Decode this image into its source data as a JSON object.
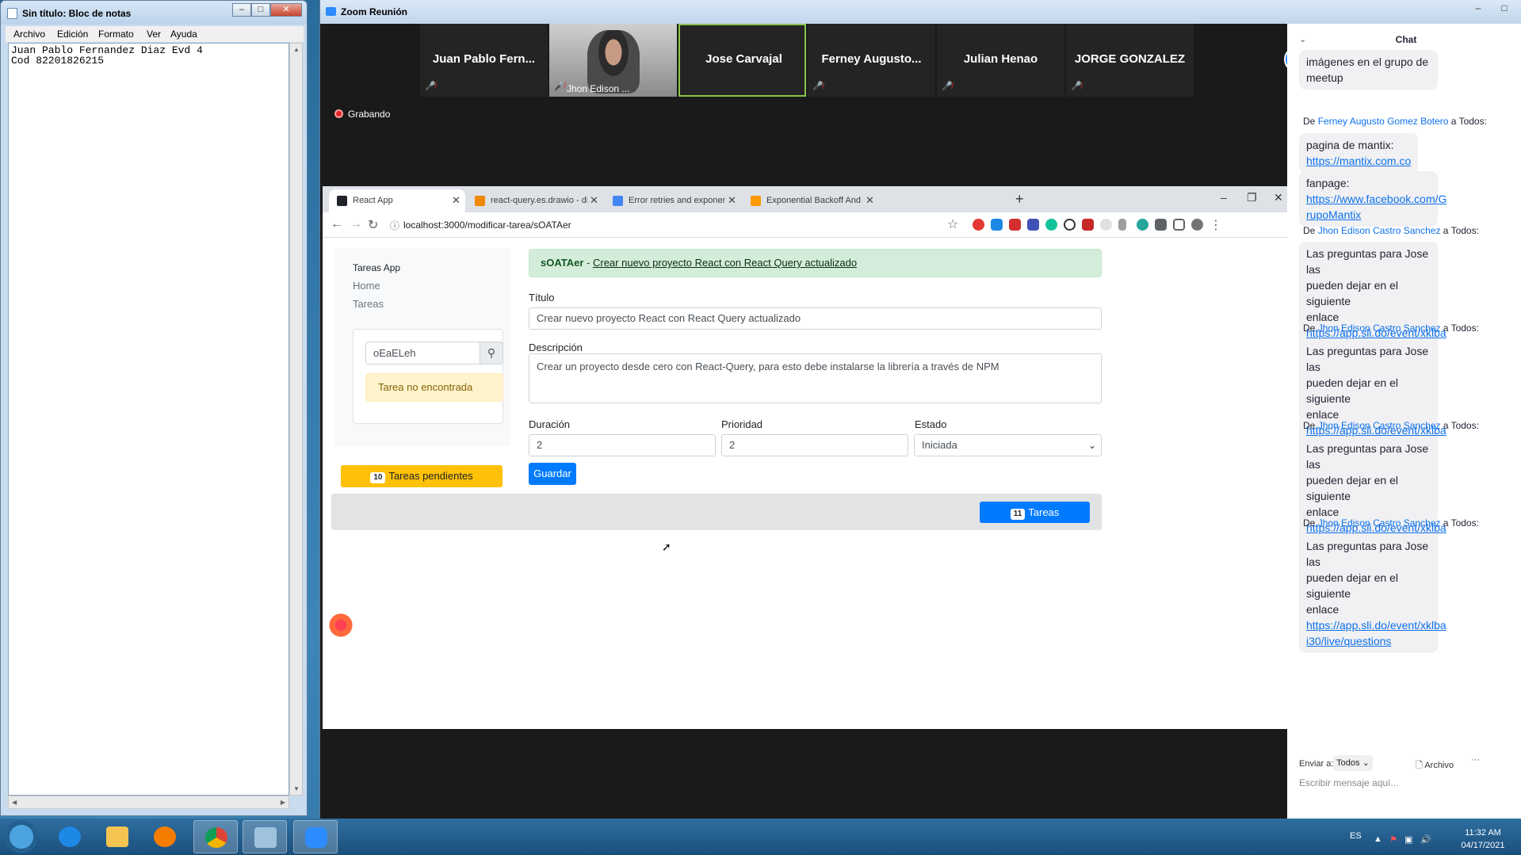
{
  "notepad": {
    "title": "Sin título: Bloc de notas",
    "menu": [
      "Archivo",
      "Edición",
      "Formato",
      "Ver",
      "Ayuda"
    ],
    "lines": [
      "Juan Pablo Fernandez Diaz Evd 4",
      "Cod 82201826215"
    ]
  },
  "zoom": {
    "title": "Zoom Reunión",
    "participants": [
      {
        "name": "Juan Pablo Fern...",
        "muted": true
      },
      {
        "name": "Jhon Edison ...",
        "muted": true,
        "video": true
      },
      {
        "name": "Jose Carvajal",
        "muted": false,
        "active": true
      },
      {
        "name": "Ferney Augusto...",
        "muted": true
      },
      {
        "name": "Julian Henao",
        "muted": true
      },
      {
        "name": "JORGE GONZALEZ",
        "muted": true
      }
    ],
    "recording_label": "Grabando"
  },
  "browser": {
    "tabs": [
      {
        "label": "React App",
        "active": true
      },
      {
        "label": "react-query.es.drawio - diagrams",
        "active": false
      },
      {
        "label": "Error retries and exponential bac",
        "active": false
      },
      {
        "label": "Exponential Backoff And Jitter | A",
        "active": false
      }
    ],
    "url": "localhost:3000/modificar-tarea/sOATAer"
  },
  "app": {
    "brand": "Tareas App",
    "nav": [
      "Home",
      "Tareas"
    ],
    "search_value": "oEaELeh",
    "not_found": "Tarea no encontrada",
    "pending_count": "10",
    "pending_label": "Tareas pendientes",
    "alert_id": "sOATAer",
    "alert_sep": " - ",
    "alert_link": "Crear nuevo proyecto React con React Query actualizado",
    "labels": {
      "titulo": "Título",
      "descripcion": "Descripción",
      "duracion": "Duración",
      "prioridad": "Prioridad",
      "estado": "Estado"
    },
    "values": {
      "titulo": "Crear nuevo proyecto React con React Query actualizado",
      "descripcion": "Crear un proyecto desde cero con React-Query, para esto debe instalarse la librería a través de NPM",
      "duracion": "2",
      "prioridad": "2",
      "estado": "Iniciada"
    },
    "save_label": "Guardar",
    "tasks_count": "11",
    "tasks_label": "Tareas"
  },
  "chat": {
    "title": "Chat",
    "first_bubble": "imágenes en el grupo de meetup",
    "messages": [
      {
        "from": "Ferney Augusto Gomez Botero",
        "to": " a Todos:",
        "prefix": "De "
      },
      {
        "from": "Jhon Edison Castro Sanchez",
        "to": " a Todos:",
        "prefix": "De "
      },
      {
        "from": "Jhon Edison Castro Sanchez",
        "to": " a Todos:",
        "prefix": "De "
      },
      {
        "from": "Jhon Edison Castro Sanchez",
        "to": " a Todos:",
        "prefix": "De "
      },
      {
        "from": "Jhon Edison Castro Sanchez",
        "to": " a Todos:",
        "prefix": "De "
      }
    ],
    "mantix_text": "pagina de mantix:",
    "mantix_link": "https://mantix.com.co",
    "fanpage_text": "fanpage:",
    "fanpage_link_1": "https://www.facebook.com/G",
    "fanpage_link_2": "rupoMantix",
    "q_text_1": "Las preguntas para Jose las",
    "q_text_2": "pueden dejar en el siguiente",
    "q_text_3": "enlace",
    "q_link_1": "https://app.sli.do/event/xklba",
    "q_link_2": "i30/live/questions",
    "send_to_label": "Enviar a:",
    "send_to_value": "Todos",
    "file_label": "Archivo",
    "input_placeholder": "Escribir mensaje aquí..."
  },
  "taskbar": {
    "language": "ES",
    "time": "11:32 AM",
    "date": "04/17/2021"
  }
}
